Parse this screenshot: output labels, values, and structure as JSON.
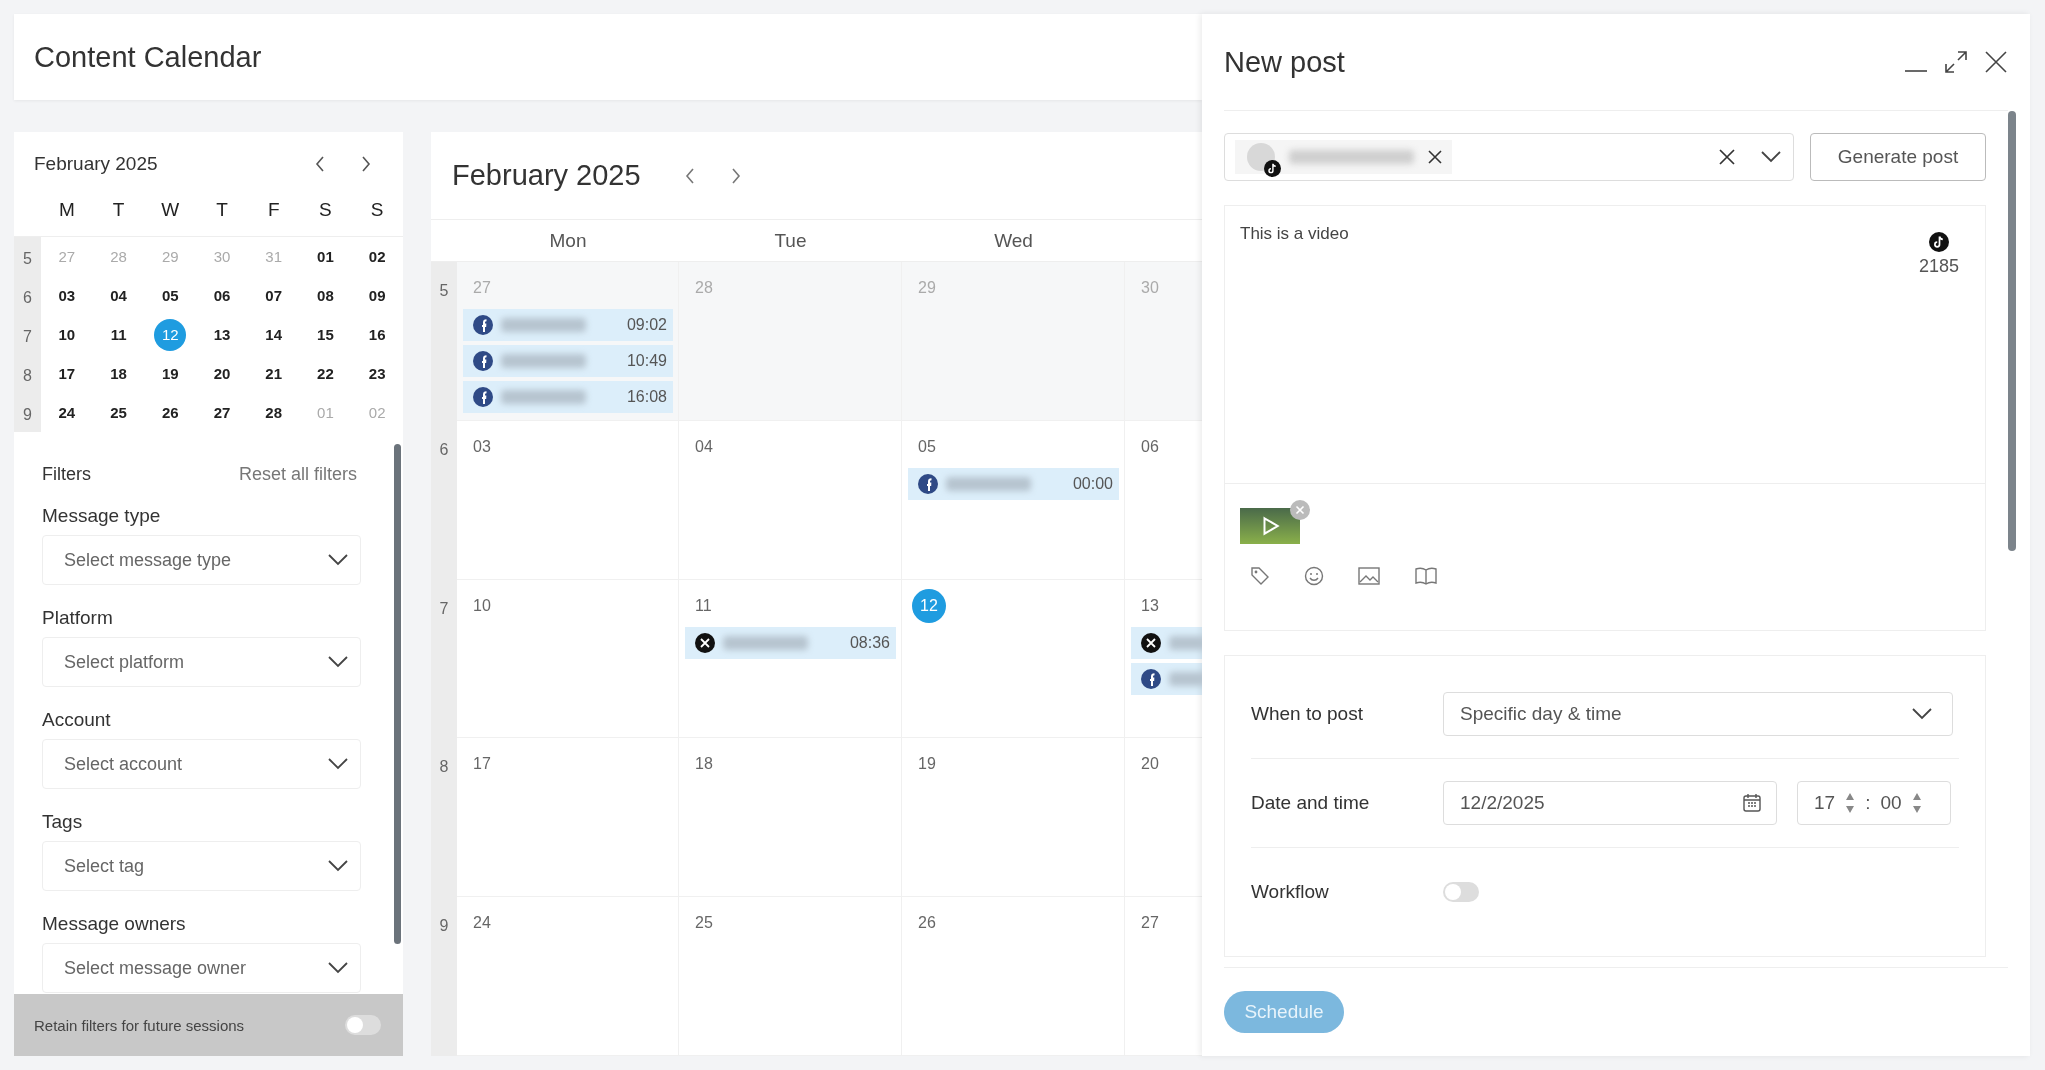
{
  "header": {
    "title": "Content Calendar"
  },
  "mini_calendar": {
    "title": "February 2025",
    "weekdays": [
      "M",
      "T",
      "W",
      "T",
      "F",
      "S",
      "S"
    ],
    "weeks": [
      {
        "number": "5",
        "days": [
          {
            "label": "27",
            "outside": true,
            "today": false
          },
          {
            "label": "28",
            "outside": true,
            "today": false
          },
          {
            "label": "29",
            "outside": true,
            "today": false
          },
          {
            "label": "30",
            "outside": true,
            "today": false
          },
          {
            "label": "31",
            "outside": true,
            "today": false
          },
          {
            "label": "01",
            "outside": false,
            "today": false
          },
          {
            "label": "02",
            "outside": false,
            "today": false
          }
        ]
      },
      {
        "number": "6",
        "days": [
          {
            "label": "03",
            "outside": false,
            "today": false
          },
          {
            "label": "04",
            "outside": false,
            "today": false
          },
          {
            "label": "05",
            "outside": false,
            "today": false
          },
          {
            "label": "06",
            "outside": false,
            "today": false
          },
          {
            "label": "07",
            "outside": false,
            "today": false
          },
          {
            "label": "08",
            "outside": false,
            "today": false
          },
          {
            "label": "09",
            "outside": false,
            "today": false
          }
        ]
      },
      {
        "number": "7",
        "days": [
          {
            "label": "10",
            "outside": false,
            "today": false
          },
          {
            "label": "11",
            "outside": false,
            "today": false
          },
          {
            "label": "12",
            "outside": false,
            "today": true
          },
          {
            "label": "13",
            "outside": false,
            "today": false
          },
          {
            "label": "14",
            "outside": false,
            "today": false
          },
          {
            "label": "15",
            "outside": false,
            "today": false
          },
          {
            "label": "16",
            "outside": false,
            "today": false
          }
        ]
      },
      {
        "number": "8",
        "days": [
          {
            "label": "17",
            "outside": false,
            "today": false
          },
          {
            "label": "18",
            "outside": false,
            "today": false
          },
          {
            "label": "19",
            "outside": false,
            "today": false
          },
          {
            "label": "20",
            "outside": false,
            "today": false
          },
          {
            "label": "21",
            "outside": false,
            "today": false
          },
          {
            "label": "22",
            "outside": false,
            "today": false
          },
          {
            "label": "23",
            "outside": false,
            "today": false
          }
        ]
      },
      {
        "number": "9",
        "days": [
          {
            "label": "24",
            "outside": false,
            "today": false
          },
          {
            "label": "25",
            "outside": false,
            "today": false
          },
          {
            "label": "26",
            "outside": false,
            "today": false
          },
          {
            "label": "27",
            "outside": false,
            "today": false
          },
          {
            "label": "28",
            "outside": false,
            "today": false
          },
          {
            "label": "01",
            "outside": true,
            "today": false
          },
          {
            "label": "02",
            "outside": true,
            "today": false
          }
        ]
      }
    ]
  },
  "filters": {
    "title": "Filters",
    "reset": "Reset all filters",
    "fields": [
      {
        "label": "Message type",
        "placeholder": "Select message type"
      },
      {
        "label": "Platform",
        "placeholder": "Select platform"
      },
      {
        "label": "Account",
        "placeholder": "Select account"
      },
      {
        "label": "Tags",
        "placeholder": "Select tag"
      },
      {
        "label": "Message owners",
        "placeholder": "Select message owner"
      }
    ],
    "retain": {
      "label": "Retain filters for future sessions",
      "on": false
    }
  },
  "calendar": {
    "title": "February 2025",
    "columns": [
      "Mon",
      "Tue",
      "Wed"
    ],
    "weeks": [
      {
        "number": "5",
        "days": [
          {
            "label": "27",
            "outside": true,
            "today": false,
            "events": [
              {
                "kind": "facebook",
                "time": "09:02"
              },
              {
                "kind": "facebook",
                "time": "10:49"
              },
              {
                "kind": "facebook",
                "time": "16:08"
              }
            ]
          },
          {
            "label": "28",
            "outside": true,
            "today": false
          },
          {
            "label": "29",
            "outside": true,
            "today": false
          },
          {
            "label": "30",
            "outside": true,
            "today": false
          }
        ]
      },
      {
        "number": "6",
        "days": [
          {
            "label": "03",
            "outside": false,
            "today": false
          },
          {
            "label": "04",
            "outside": false,
            "today": false
          },
          {
            "label": "05",
            "outside": false,
            "today": false,
            "events": [
              {
                "kind": "facebook",
                "time": "00:00"
              }
            ]
          },
          {
            "label": "06",
            "outside": false,
            "today": false
          }
        ]
      },
      {
        "number": "7",
        "days": [
          {
            "label": "10",
            "outside": false,
            "today": false
          },
          {
            "label": "11",
            "outside": false,
            "today": false,
            "events": [
              {
                "kind": "x",
                "time": "08:36"
              }
            ]
          },
          {
            "label": "12",
            "outside": false,
            "today": true
          },
          {
            "label": "13",
            "outside": false,
            "today": false,
            "events": [
              {
                "kind": "x"
              },
              {
                "kind": "facebook"
              }
            ]
          }
        ]
      },
      {
        "number": "8",
        "days": [
          {
            "label": "17",
            "outside": false,
            "today": false
          },
          {
            "label": "18",
            "outside": false,
            "today": false
          },
          {
            "label": "19",
            "outside": false,
            "today": false
          },
          {
            "label": "20",
            "outside": false,
            "today": false
          }
        ]
      },
      {
        "number": "9",
        "days": [
          {
            "label": "24",
            "outside": false,
            "today": false
          },
          {
            "label": "25",
            "outside": false,
            "today": false
          },
          {
            "label": "26",
            "outside": false,
            "today": false
          },
          {
            "label": "27",
            "outside": false,
            "today": false
          }
        ]
      }
    ]
  },
  "new_post": {
    "title": "New post",
    "account": {
      "kind": "tiktok"
    },
    "generate": "Generate post",
    "text": "This is a video",
    "counter": {
      "kind": "tiktok",
      "count": "2185"
    },
    "when": {
      "label": "When to post",
      "value": "Specific day & time"
    },
    "date": {
      "label": "Date and time",
      "value": "12/2/2025",
      "hour": "17",
      "separator": ":",
      "minute": "00"
    },
    "workflow": {
      "label": "Workflow",
      "on": false
    },
    "schedule": "Schedule"
  }
}
